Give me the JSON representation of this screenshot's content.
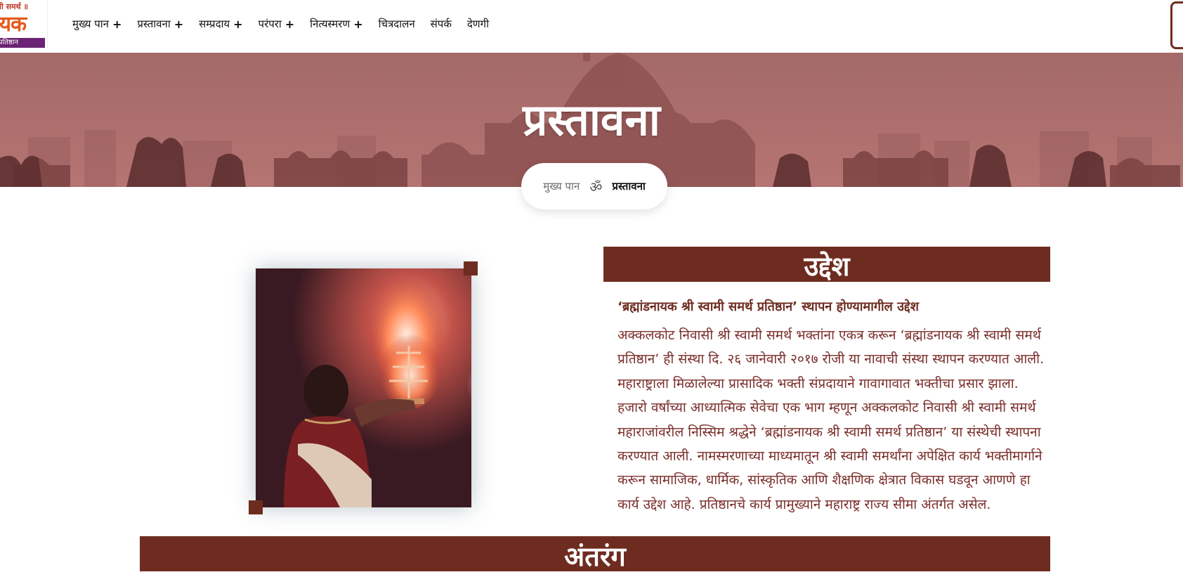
{
  "header": {
    "logo": {
      "line1": "ामी समर्थ ॥",
      "line2": "ायक",
      "line3": "प्रतिष्ठान"
    },
    "nav": [
      {
        "label": "मुख्य पान",
        "has_submenu": true
      },
      {
        "label": "प्रस्तावना",
        "has_submenu": true
      },
      {
        "label": "सम्प्रदाय",
        "has_submenu": true
      },
      {
        "label": "परंपरा",
        "has_submenu": true
      },
      {
        "label": "नित्यस्मरण",
        "has_submenu": true
      },
      {
        "label": "चित्रदालन",
        "has_submenu": false
      },
      {
        "label": "संपर्क",
        "has_submenu": false
      },
      {
        "label": "देणगी",
        "has_submenu": false
      }
    ],
    "submenu_indicator": "+"
  },
  "banner": {
    "title": "प्रस्तावना",
    "breadcrumb": {
      "home": "मुख्य पान",
      "separator": "ॐ",
      "current": "प्रस्तावना"
    }
  },
  "objective": {
    "heading": "उद्देश",
    "subheading": "‘ब्रह्मांडनायक श्री स्वामी समर्थ प्रतिष्ठान’ स्थापन होण्यामागील उद्देश",
    "body_lines": [
      "अक्कलकोट निवासी श्री स्वामी समर्थ भक्तांना एकत्र करून ‘ब्रह्मांडनायक श्री स्वामी समर्थ",
      "प्रतिष्ठान’ ही संस्था दि. २६ जानेवारी २०१७ रोजी या नावाची संस्था स्थापन करण्यात आली.",
      "महाराष्ट्राला मिळालेल्या प्रासादिक भक्ती संप्रदायाने गावागावात भक्तीचा प्रसार झाला.",
      "हजारो वर्षांच्या आध्यात्मिक सेवेचा एक भाग म्हणून अक्कलकोट निवासी श्री स्वामी समर्थ",
      "महाराजांवरील निस्सिम श्रद्धेने ‘ब्रह्मांडनायक श्री स्वामी समर्थ प्रतिष्ठान’ या संस्थेची स्थापना",
      "करण्यात आली. नामस्मरणाच्या माध्यमातून श्री स्वामी समर्थांना अपेक्षित कार्य भक्तीमार्गाने",
      "करून सामाजिक, धार्मिक, सांस्कृतिक आणि शैक्षणिक क्षेत्रात विकास घडवून आणणे हा",
      "कार्य उद्देश आहे. प्रतिष्ठानचे कार्य प्रामुख्याने महाराष्ट्र राज्य सीमा अंतर्गत असेल."
    ]
  },
  "inner_section": {
    "heading": "अंतरंग"
  },
  "colors": {
    "brand": "#6e2c20",
    "body_text": "#7a2e2a",
    "banner_overlay": "#a86b6a",
    "logo_orange": "#e8591a",
    "logo_purple": "#6a2473"
  }
}
